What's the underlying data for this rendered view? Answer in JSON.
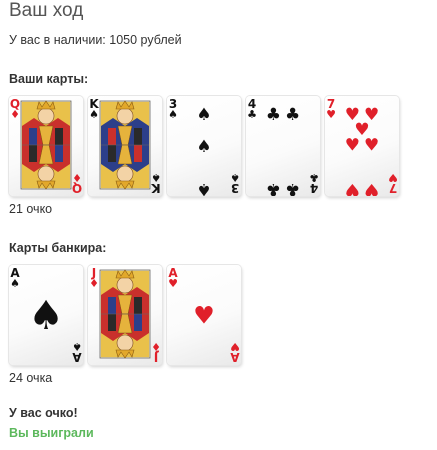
{
  "header": {
    "title": "Ваш ход",
    "balance": "У вас в наличии: 1050 рублей"
  },
  "player": {
    "heading": "Ваши карты:",
    "points": "21 очко",
    "cards": [
      {
        "rank": "Q",
        "suit": "diamonds",
        "suit_symbol": "♦",
        "color": "#e0202a",
        "face": true
      },
      {
        "rank": "K",
        "suit": "spades",
        "suit_symbol": "♠",
        "color": "#111111",
        "face": true
      },
      {
        "rank": "3",
        "suit": "spades",
        "suit_symbol": "♠",
        "color": "#111111",
        "face": false
      },
      {
        "rank": "4",
        "suit": "clubs",
        "suit_symbol": "♣",
        "color": "#111111",
        "face": false
      },
      {
        "rank": "7",
        "suit": "hearts",
        "suit_symbol": "♥",
        "color": "#e0202a",
        "face": false
      }
    ]
  },
  "dealer": {
    "heading": "Карты банкира:",
    "points": "24 очка",
    "cards": [
      {
        "rank": "A",
        "suit": "spades",
        "suit_symbol": "♠",
        "color": "#111111",
        "face": false
      },
      {
        "rank": "J",
        "suit": "diamonds",
        "suit_symbol": "♦",
        "color": "#e0202a",
        "face": true
      },
      {
        "rank": "A",
        "suit": "hearts",
        "suit_symbol": "♥",
        "color": "#e0202a",
        "face": false
      }
    ]
  },
  "result": {
    "line1": "У вас очко!",
    "line2": "Вы выиграли",
    "win_color": "#5cb85c"
  }
}
